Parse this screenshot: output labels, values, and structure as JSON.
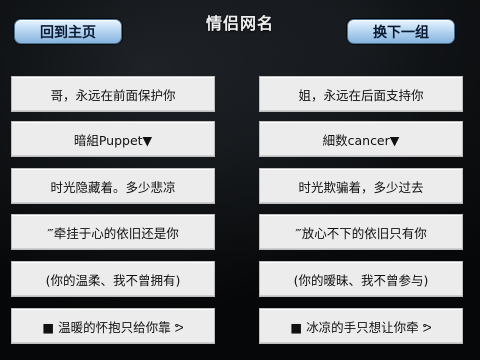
{
  "header": {
    "title": "情侣网名",
    "home_button": "回到主页",
    "next_button": "换下一组"
  },
  "pairs": [
    {
      "left": "哥，永远在前面保护你",
      "right": "姐，永远在后面支持你"
    },
    {
      "left": "暗組Puppet▼",
      "right": "細数cancer▼"
    },
    {
      "left": "时光隐藏着。多少悲凉",
      "right": "时光欺骗着，多少过去"
    },
    {
      "left": "‴牵挂于心的依旧还是你",
      "right": "‴放心不下的依旧只有你"
    },
    {
      "left": "(你的温柔、我不曾拥有)",
      "right": "(你的暧昧、我不曾参与)"
    },
    {
      "left": "■ 温暖的怀抱只给你靠 ᕗ",
      "right": "■ 冰凉的手只想让你牵 ᕗ"
    }
  ]
}
